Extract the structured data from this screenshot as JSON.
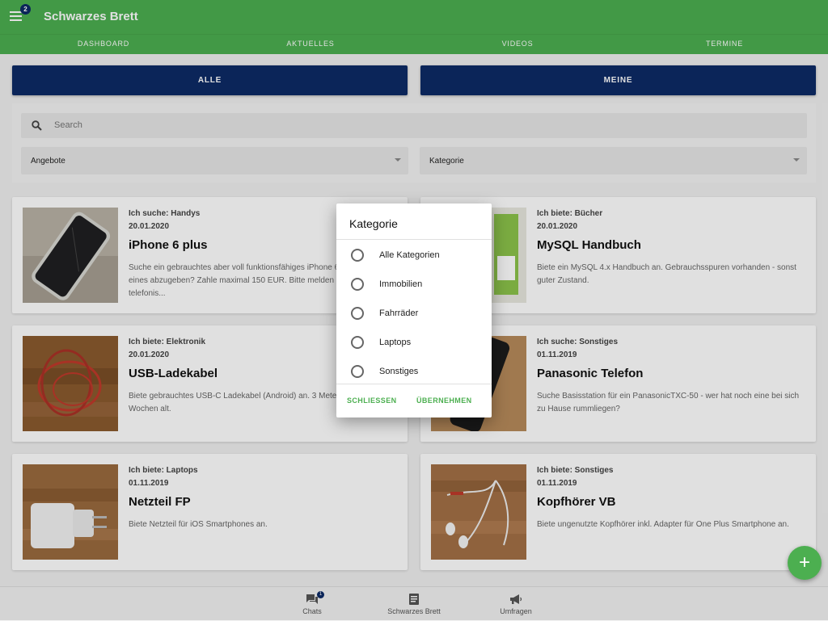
{
  "header": {
    "title": "Schwarzes Brett",
    "menu_badge": "2"
  },
  "tabs": [
    {
      "label": "DASHBOARD"
    },
    {
      "label": "AKTUELLES"
    },
    {
      "label": "VIDEOS"
    },
    {
      "label": "TERMINE"
    }
  ],
  "segments": {
    "all_label": "ALLE",
    "mine_label": "MEINE"
  },
  "search": {
    "placeholder": "Search"
  },
  "filters": {
    "offer_type": "Angebote",
    "category": "Kategorie"
  },
  "cards": [
    {
      "type": "Ich suche: Handys",
      "date": "20.01.2020",
      "title": "iPhone 6 plus",
      "description": "Suche ein gebrauchtes aber voll funktionsfähiges iPhone 6 plus. Wer hat eines abzugeben? Zahle maximal 150 EUR. Bitte melden per Mail oder telefonis..."
    },
    {
      "type": "Ich biete: Bücher",
      "date": "20.01.2020",
      "title": "MySQL Handbuch",
      "description": "Biete ein MySQL 4.x Handbuch an. Gebrauchsspuren vorhanden - sonst guter Zustand."
    },
    {
      "type": "Ich biete: Elektronik",
      "date": "20.01.2020",
      "title": "USB-Ladekabel",
      "description": "Biete gebrauchtes USB-C Ladekabel (Android) an. 3 Meter lang, 2 Wochen alt."
    },
    {
      "type": "Ich suche: Sonstiges",
      "date": "01.11.2019",
      "title": "Panasonic Telefon",
      "description": "Suche Basisstation für ein PanasonicTXC-50 - wer hat noch eine bei sich zu Hause rummliegen?"
    },
    {
      "type": "Ich biete: Laptops",
      "date": "01.11.2019",
      "title": "Netzteil FP",
      "description": "Biete Netzteil für iOS Smartphones an."
    },
    {
      "type": "Ich biete: Sonstiges",
      "date": "01.11.2019",
      "title": "Kopfhörer VB",
      "description": "Biete ungenutzte Kopfhörer inkl. Adapter für One Plus Smartphone an."
    }
  ],
  "dialog": {
    "title": "Kategorie",
    "options": [
      {
        "label": "Alle Kategorien"
      },
      {
        "label": "Immobilien"
      },
      {
        "label": "Fahrräder"
      },
      {
        "label": "Laptops"
      },
      {
        "label": "Sonstiges"
      }
    ],
    "close_label": "SCHLIESSEN",
    "apply_label": "ÜBERNEHMEN"
  },
  "fab": {
    "icon": "plus-icon",
    "symbol": "+"
  },
  "bottom_nav": [
    {
      "label": "Chats",
      "icon": "chat-icon",
      "badge": "1"
    },
    {
      "label": "Schwarzes Brett",
      "icon": "board-icon"
    },
    {
      "label": "Umfragen",
      "icon": "megaphone-icon"
    }
  ],
  "colors": {
    "primary_green": "#4caf50",
    "navy": "#0d2b66"
  }
}
